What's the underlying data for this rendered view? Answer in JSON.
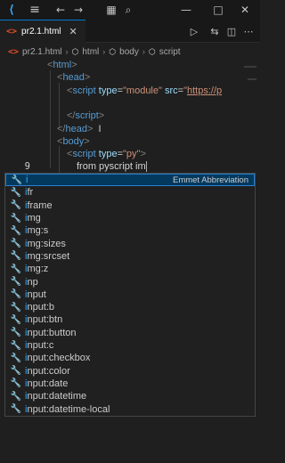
{
  "titlebar": {
    "icons": [
      "vscode-logo",
      "menu-icon",
      "back-arrow-icon",
      "forward-arrow-icon",
      "layout-icon",
      "search-icon",
      "minimize-icon",
      "maximize-icon",
      "close-icon"
    ],
    "logo_glyph": "⟨",
    "menu_glyph": "≡",
    "back_glyph": "←",
    "forward_glyph": "→",
    "layout_glyph": "▦",
    "search_glyph": "⌕",
    "minimize_glyph": "—",
    "maximize_glyph": "□",
    "close_glyph": "✕"
  },
  "tabs": [
    {
      "label": "pr2.1.html",
      "icon": "html5-icon",
      "icon_glyph": "<>",
      "close_glyph": "✕",
      "active": true
    }
  ],
  "tab_actions": {
    "run_glyph": "▷",
    "compare_glyph": "⇆",
    "split_glyph": "◫",
    "more_glyph": "⋯"
  },
  "breadcrumb": {
    "items": [
      "pr2.1.html",
      "html",
      "body",
      "script"
    ],
    "html_glyph": "<>",
    "sep": "›",
    "cube_glyph": "⬡"
  },
  "editor": {
    "lines": [
      {
        "n": "",
        "indent": 0,
        "tokens": [
          [
            "t-punc",
            "<"
          ],
          [
            "t-tag",
            "html"
          ],
          [
            "t-punc",
            ">"
          ]
        ]
      },
      {
        "n": "",
        "indent": 1,
        "tokens": [
          [
            "t-punc",
            "<"
          ],
          [
            "t-tag",
            "head"
          ],
          [
            "t-punc",
            ">"
          ]
        ]
      },
      {
        "n": "",
        "indent": 2,
        "tokens": [
          [
            "t-punc",
            "<"
          ],
          [
            "t-tag",
            "script"
          ],
          [
            "t-text",
            " "
          ],
          [
            "t-attr",
            "type"
          ],
          [
            "t-text",
            "="
          ],
          [
            "t-str",
            "\"module\""
          ],
          [
            "t-text",
            " "
          ],
          [
            "t-attr",
            "src"
          ],
          [
            "t-text",
            "="
          ],
          [
            "t-str",
            "\""
          ],
          [
            "t-url",
            "https://p"
          ]
        ]
      },
      {
        "n": "",
        "indent": 0,
        "tokens": []
      },
      {
        "n": "",
        "indent": 2,
        "tokens": [
          [
            "t-punc",
            "</"
          ],
          [
            "t-tag",
            "script"
          ],
          [
            "t-punc",
            ">"
          ]
        ]
      },
      {
        "n": "",
        "indent": 1,
        "tokens": [
          [
            "t-punc",
            "</"
          ],
          [
            "t-tag",
            "head"
          ],
          [
            "t-punc",
            ">"
          ],
          [
            "t-text",
            "  I"
          ]
        ]
      },
      {
        "n": "",
        "indent": 1,
        "tokens": [
          [
            "t-punc",
            "<"
          ],
          [
            "t-tag",
            "body"
          ],
          [
            "t-punc",
            ">"
          ]
        ]
      },
      {
        "n": "",
        "indent": 2,
        "tokens": [
          [
            "t-punc",
            "<"
          ],
          [
            "t-tag",
            "script"
          ],
          [
            "t-text",
            " "
          ],
          [
            "t-attr",
            "type"
          ],
          [
            "t-text",
            "="
          ],
          [
            "t-str",
            "\"py\""
          ],
          [
            "t-punc",
            ">"
          ]
        ]
      },
      {
        "n": "9",
        "indent": 3,
        "tokens": [
          [
            "t-text",
            "from pyscript im"
          ]
        ],
        "cursor": true,
        "active": true
      }
    ]
  },
  "suggest": {
    "items": [
      {
        "match": "i",
        "rest": "",
        "detail": "Emmet Abbreviation",
        "selected": true
      },
      {
        "match": "i",
        "rest": "fr"
      },
      {
        "match": "i",
        "rest": "frame"
      },
      {
        "match": "i",
        "rest": "mg"
      },
      {
        "match": "i",
        "rest": "mg:s"
      },
      {
        "match": "i",
        "rest": "mg:sizes"
      },
      {
        "match": "i",
        "rest": "mg:srcset"
      },
      {
        "match": "i",
        "rest": "mg:z"
      },
      {
        "match": "i",
        "rest": "np"
      },
      {
        "match": "i",
        "rest": "nput"
      },
      {
        "match": "i",
        "rest": "nput:b"
      },
      {
        "match": "i",
        "rest": "nput:btn"
      },
      {
        "match": "i",
        "rest": "nput:button"
      },
      {
        "match": "i",
        "rest": "nput:c"
      },
      {
        "match": "i",
        "rest": "nput:checkbox"
      },
      {
        "match": "i",
        "rest": "nput:color"
      },
      {
        "match": "i",
        "rest": "nput:date"
      },
      {
        "match": "i",
        "rest": "nput:datetime"
      },
      {
        "match": "i",
        "rest": "nput:datetime-local"
      }
    ],
    "item_icon": "wrench-icon",
    "item_glyph": "🔧"
  },
  "colors": {
    "accent": "#0078d4",
    "match": "#2aaaff",
    "selection": "#04395e"
  }
}
